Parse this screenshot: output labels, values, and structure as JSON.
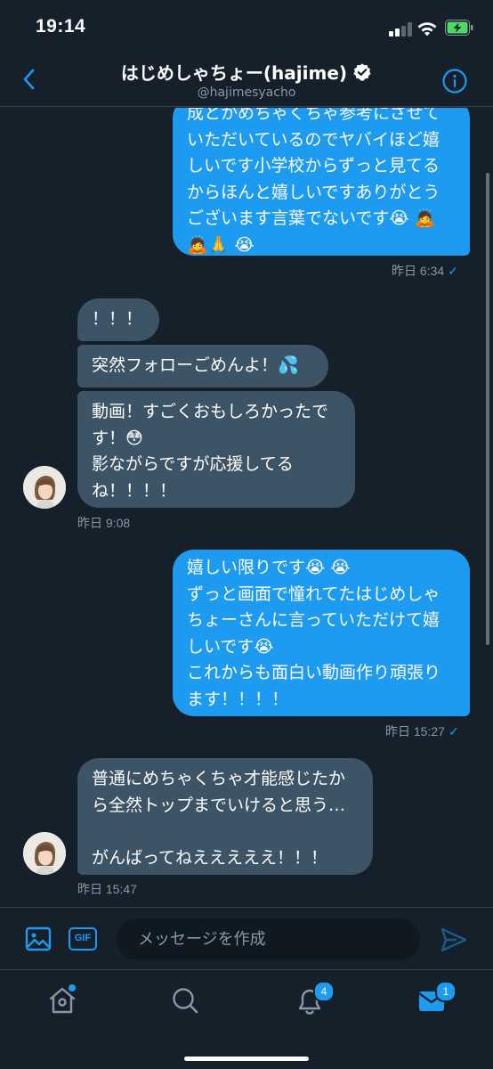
{
  "status_bar": {
    "time": "19:14",
    "signal_icon": "cellular-signal-icon",
    "wifi_icon": "wifi-icon",
    "battery_icon": "battery-charging-icon",
    "battery_color": "#4cd964"
  },
  "header": {
    "title": "はじめしゃちょー(hajime)",
    "handle": "@hajimesyacho",
    "back_icon": "chevron-left-icon",
    "info_icon": "info-icon",
    "verified_icon": "verified-badge-icon"
  },
  "conversation": {
    "messages": [
      {
        "direction": "outgoing",
        "text": "成とかめちゃくちゃ参考にさせて\nいただいているのでヤバイほど嬉\nしいです小学校からずっと見てる\nからほんと嬉しいですありがとう\nございます言葉でないです😭 🙇\n🙇🙏 😭"
      },
      {
        "direction": "outgoing",
        "time": "昨日 6:34",
        "read": "✓"
      },
      {
        "direction": "incoming",
        "text": "！！！"
      },
      {
        "direction": "incoming",
        "text": "突然フォローごめんよ！💦"
      },
      {
        "direction": "incoming",
        "text": "動画！すごくおもしろかったで\nす！😳\n影ながらですが応援してる\nね！！！！"
      },
      {
        "direction": "incoming",
        "time": "昨日 9:08"
      },
      {
        "direction": "outgoing",
        "text": "嬉しい限りです😭 😭\nずっと画面で憧れてたはじめしゃ\nちょーさんに言っていただけて嬉\nしいです😭\nこれからも面白い動画作り頑張り\nます！！！！"
      },
      {
        "direction": "outgoing",
        "time": "昨日 15:27",
        "read": "✓"
      },
      {
        "direction": "incoming",
        "text": "普通にめちゃくちゃ才能感じたか\nら全然トップまでいけると思う…\n\nがんばってねえええええ！！！"
      },
      {
        "direction": "incoming",
        "time": "昨日 15:47"
      }
    ]
  },
  "composer": {
    "placeholder": "メッセージを作成",
    "image_icon": "image-icon",
    "gif_label": "GIF",
    "send_icon": "send-icon"
  },
  "tabbar": {
    "home_icon": "home-icon",
    "search_icon": "search-icon",
    "notifications_icon": "bell-icon",
    "notifications_badge": "4",
    "messages_icon": "mail-icon",
    "messages_badge": "1",
    "accent": "#1d9bf0"
  }
}
